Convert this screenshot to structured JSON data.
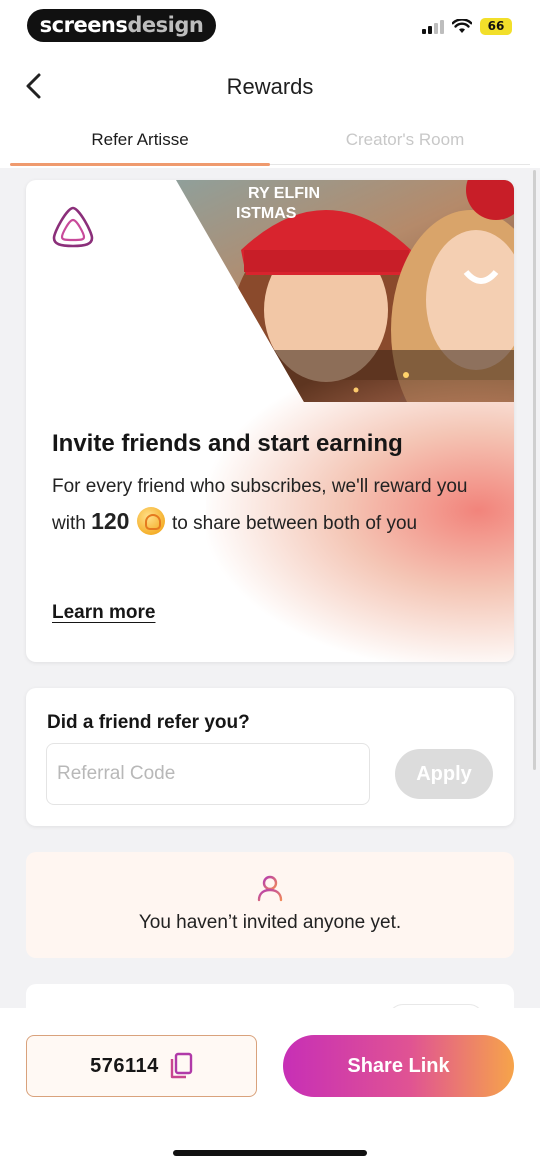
{
  "status_bar": {
    "brand_part1": "screens",
    "brand_part2": "design",
    "battery": "66"
  },
  "header": {
    "title": "Rewards",
    "tabs": [
      {
        "label": "Refer Artisse",
        "active": true
      },
      {
        "label": "Creator's Room",
        "active": false
      }
    ]
  },
  "hero": {
    "photo_sign_line1": "RY ELFIN",
    "photo_sign_line2": "ISTMAS",
    "title": "Invite friends and start earning",
    "text_before": "For every friend who subscribes, we'll reward you with ",
    "amount": "120",
    "text_after": " to share between both of you",
    "learn_more": "Learn more"
  },
  "referral": {
    "label": "Did a friend refer you?",
    "input_placeholder": "Referral Code",
    "input_value": "",
    "apply_label": "Apply"
  },
  "invites": {
    "icon": "person-icon",
    "empty_text": "You haven’t invited anyone yet."
  },
  "bottom": {
    "code": "576114",
    "copy_icon": "copy-icon",
    "share_label": "Share Link"
  },
  "colors": {
    "accent_underline": "#ef9a6e",
    "share_gradient_start": "#c72fb6",
    "share_gradient_end": "#f6a44a",
    "brand_purple": "#8b2f7a"
  }
}
